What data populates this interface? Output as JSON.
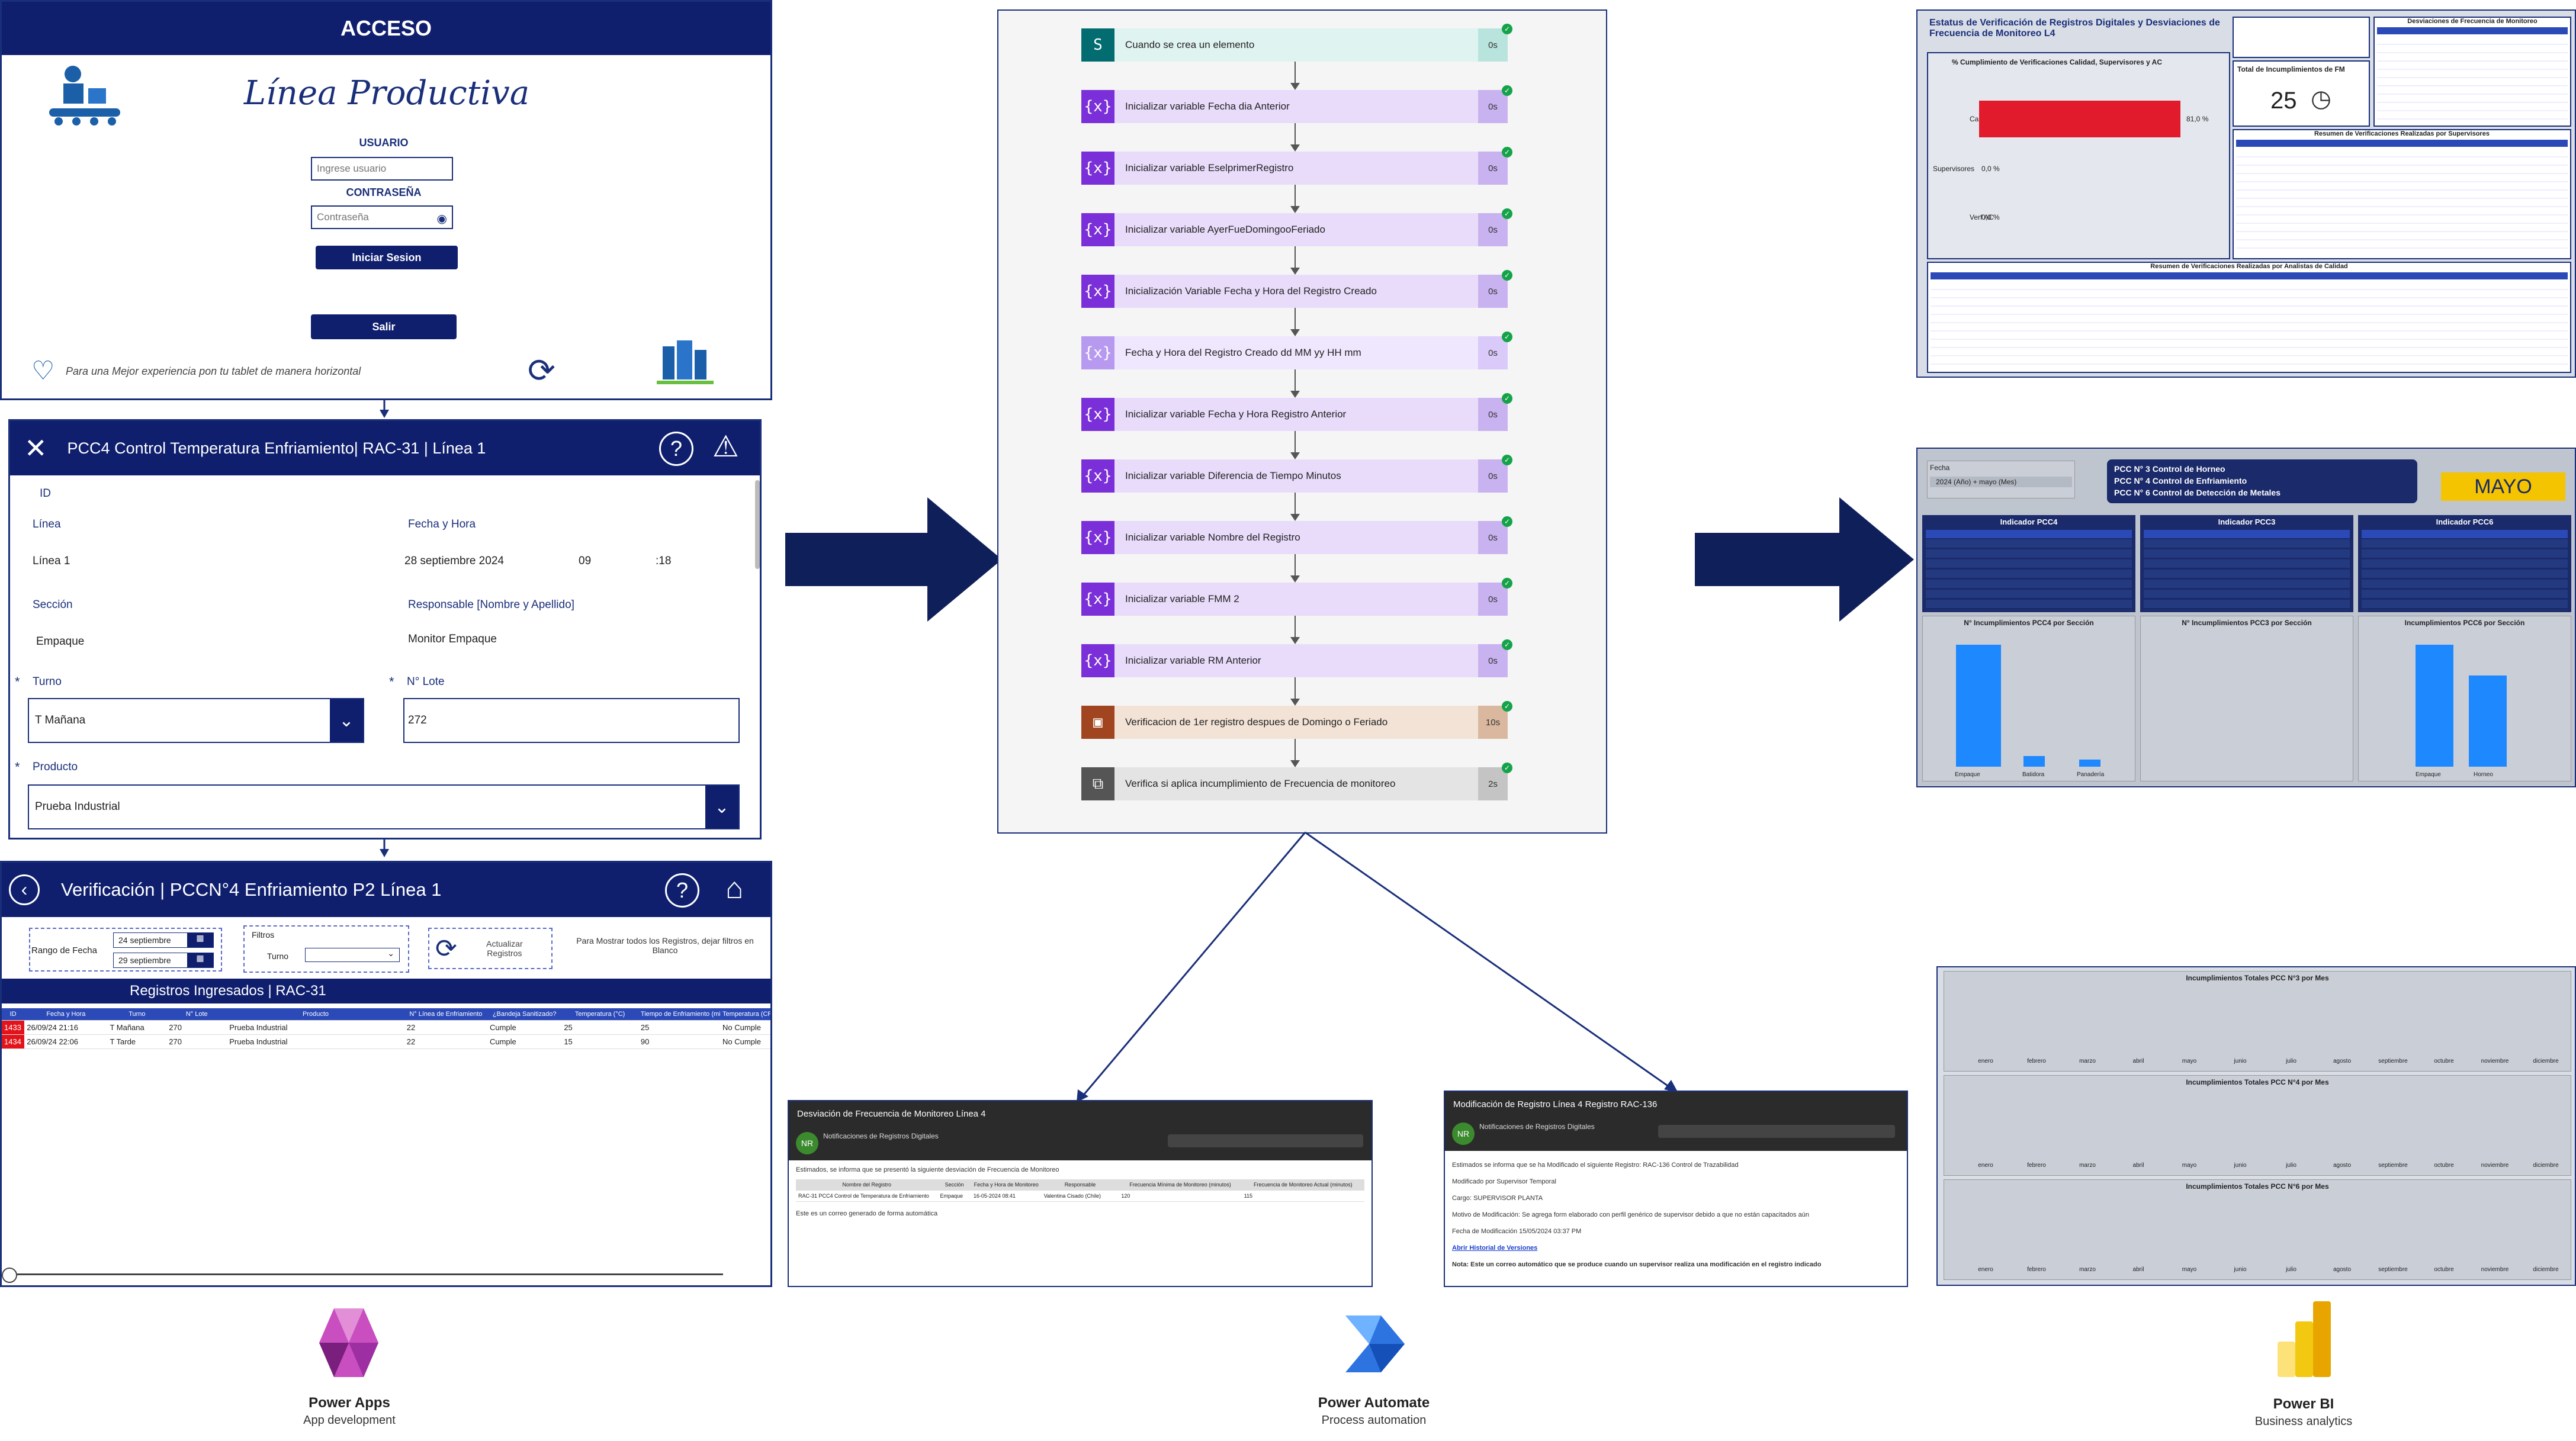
{
  "powerapps": {
    "login": {
      "header": "ACCESO",
      "title": "Línea Productiva",
      "user_label": "USUARIO",
      "user_placeholder": "Ingrese usuario",
      "pass_label": "CONTRASEÑA",
      "pass_placeholder": "Contraseña",
      "login_button": "Iniciar Sesion",
      "exit_button": "Salir",
      "footer_text": "Para una Mejor experiencia pon tu tablet de manera horizontal"
    },
    "form": {
      "header": "PCC4 Control Temperatura Enfriamiento| RAC-31 | Línea 1",
      "id_label": "ID",
      "linea_label": "Línea",
      "linea_value": "Línea 1",
      "fecha_label": "Fecha y Hora",
      "fecha_value": "28 septiembre 2024",
      "hora_value": "09",
      "min_value": ":18",
      "seccion_label": "Sección",
      "seccion_value": "Empaque",
      "responsable_label": "Responsable [Nombre y Apellido]",
      "responsable_value": "Monitor Empaque",
      "turno_label": "Turno",
      "turno_value": "T Mañana",
      "lote_label": "N° Lote",
      "lote_value": "272",
      "producto_label": "Producto",
      "producto_value": "Prueba Industrial"
    },
    "verif": {
      "header": "Verificación | PCCN°4 Enfriamiento P2 Línea 1",
      "rango_label": "Rango de Fecha",
      "date_from": "24 septiembre",
      "date_to": "29 septiembre",
      "filtros_label": "Filtros",
      "turno_label": "Turno",
      "actualizar_label": "Actualizar Registros",
      "hint": "Para Mostrar todos los Registros, dejar filtros en Blanco",
      "table_title": "Registros Ingresados | RAC-31",
      "columns": [
        "ID",
        "Fecha y Hora",
        "Turno",
        "N° Lote",
        "Producto",
        "N° Línea de Enfriamiento",
        "¿Bandeja Sanitizado?",
        "Temperatura (°C)",
        "Tiempo de Enfriamiento (min)",
        "Temperatura (CPK)"
      ],
      "rows": [
        [
          "1433",
          "26/09/24 21:16",
          "T Mañana",
          "270",
          "Prueba Industrial",
          "22",
          "Cumple",
          "25",
          "25",
          "No Cumple"
        ],
        [
          "1434",
          "26/09/24 22:06",
          "T Tarde",
          "270",
          "Prueba Industrial",
          "22",
          "Cumple",
          "15",
          "90",
          "No Cumple"
        ]
      ]
    }
  },
  "flow": {
    "steps": [
      {
        "label": "Cuando se crea un elemento",
        "time": "0s",
        "icon": "S",
        "color": "#036c70",
        "bg": "#dff3f0",
        "tbg": "#b9e4dd"
      },
      {
        "label": "Inicializar variable Fecha dia Anterior",
        "time": "0s",
        "icon": "{x}",
        "color": "#7a2fd8",
        "bg": "#e9dcfb",
        "tbg": "#c9b2f0"
      },
      {
        "label": "Inicializar variable EselprimerRegistro",
        "time": "0s",
        "icon": "{x}",
        "color": "#7a2fd8",
        "bg": "#e9dcfb",
        "tbg": "#c9b2f0"
      },
      {
        "label": "Inicializar variable AyerFueDomingooFeriado",
        "time": "0s",
        "icon": "{x}",
        "color": "#7a2fd8",
        "bg": "#e9dcfb",
        "tbg": "#c9b2f0"
      },
      {
        "label": "Inicialización Variable Fecha y Hora del Registro Creado",
        "time": "0s",
        "icon": "{x}",
        "color": "#7a2fd8",
        "bg": "#e9dcfb",
        "tbg": "#c9b2f0"
      },
      {
        "label": "Fecha y Hora del Registro Creado dd MM yy HH mm",
        "time": "0s",
        "icon": "{x}",
        "color": "#b79af0",
        "bg": "#efe7fd",
        "tbg": "#d9cafa"
      },
      {
        "label": "Inicializar variable Fecha y Hora Registro Anterior",
        "time": "0s",
        "icon": "{x}",
        "color": "#7a2fd8",
        "bg": "#e9dcfb",
        "tbg": "#c9b2f0"
      },
      {
        "label": "Inicializar variable Diferencia de Tiempo Minutos",
        "time": "0s",
        "icon": "{x}",
        "color": "#7a2fd8",
        "bg": "#e9dcfb",
        "tbg": "#c9b2f0"
      },
      {
        "label": "Inicializar variable Nombre del Registro",
        "time": "0s",
        "icon": "{x}",
        "color": "#7a2fd8",
        "bg": "#e9dcfb",
        "tbg": "#c9b2f0"
      },
      {
        "label": "Inicializar variable FMM 2",
        "time": "0s",
        "icon": "{x}",
        "color": "#7a2fd8",
        "bg": "#e9dcfb",
        "tbg": "#c9b2f0"
      },
      {
        "label": "Inicializar variable RM Anterior",
        "time": "0s",
        "icon": "{x}",
        "color": "#7a2fd8",
        "bg": "#e9dcfb",
        "tbg": "#c9b2f0"
      },
      {
        "label": "Verificacion de 1er registro despues de Domingo o Feriado",
        "time": "10s",
        "icon": "▣",
        "color": "#a0451f",
        "bg": "#f3e3d6",
        "tbg": "#d9b89f"
      },
      {
        "label": "Verifica si aplica incumplimiento de Frecuencia de monitoreo",
        "time": "2s",
        "icon": "⧉",
        "color": "#555555",
        "bg": "#e4e4e4",
        "tbg": "#c4c4c4"
      }
    ]
  },
  "emails": {
    "left": {
      "subject": "Desviación de Frecuencia de Monitoreo Línea 4",
      "sender": "Notificaciones de Registros Digitales",
      "body": "Estimados, se informa que se presentó la siguiente desviación de Frecuencia de Monitoreo",
      "cols": [
        "Nombre del Registro",
        "Sección",
        "Fecha y Hora de Monitoreo",
        "Responsable",
        "Frecuencia Mínima de Monitoreo (minutos)",
        "Frecuencia de Monitoreo Actual (minutos)"
      ],
      "row": [
        "RAC-31 PCC4 Control de Temperatura de Enfriamiento",
        "Empaque",
        "16-05-2024 08:41",
        "Valentina Cisado (Chile)",
        "120",
        "115"
      ],
      "footer": "Este es un correo generado de forma automática"
    },
    "right": {
      "subject": "Modificación de Registro  Línea 4 Registro RAC-136",
      "sender": "Notificaciones de Registros Digitales",
      "line1": "Estimados se informa que se ha Modificado el siguiente Registro: RAC-136 Control de Trazabilidad",
      "line2": "Modificado por Supervisor Temporal",
      "line3": "Cargo: SUPERVISOR PLANTA",
      "line4": "Motivo de Modificación: Se agrega form elaborado con perfil genérico de supervisor debido a que no están capacitados aún",
      "line5": "Fecha de Modificación 15/05/2024 03:37 PM",
      "link": "Abrir Historial de Versiones",
      "note": "Nota: Este un correo automático que se produce cuando un supervisor realiza una modificación en el registro indicado"
    }
  },
  "bi": {
    "d1": {
      "title": "Estatus de Verificación de Registros Digitales y Desviaciones de Frecuencia de Monitoreo L4",
      "pct_title": "% Cumplimiento de Verificaciones Calidad, Supervisores y AC",
      "calidad_label": "Calidad",
      "calidad_value": "81,0 %",
      "sup_label": "Supervisores",
      "sup_value": "0,0 %",
      "verf_label": "Verf AC",
      "verf_value": "0,0 %",
      "total_label": "Total de Incumplimientos de FM",
      "total_value": "25",
      "desv_title": "Desviaciones de Frecuencia de Monitoreo",
      "resumen_sup": "Resumen de Verificaciones Realizadas por Supervisores",
      "resumen_cal": "Resumen de Verificaciones Realizadas por Analistas de Calidad"
    },
    "d2": {
      "fecha_label": "Fecha",
      "fecha_value": "2024 (Año) + mayo (Mes)",
      "pcc_lines": [
        "PCC N° 3 Control de Horneo",
        "PCC N° 4 Control de Enfriamiento",
        "PCC N° 6 Control de Detección de Metales"
      ],
      "month": "MAYO",
      "ind4": "Indicador PCC4",
      "ind3": "Indicador PCC3",
      "ind6": "Indicador PCC6",
      "ch4": "N° Incumplimientos PCC4 por Sección",
      "ch3": "N° Incumplimientos PCC3 por Sección",
      "ch6": "Incumplimientos PCC6 por Sección",
      "cat1": "Empaque",
      "cat2": "Batidora",
      "cat3": "Panadería",
      "cat4": "Empaque",
      "cat5": "Horneo"
    },
    "d3": {
      "t1": "Incumplimientos Totales PCC N°3 por Mes",
      "t2": "Incumplimientos Totales PCC N°4 por Mes",
      "t3": "Incumplimientos Totales PCC N°6 por Mes",
      "months": [
        "enero",
        "febrero",
        "marzo",
        "abril",
        "mayo",
        "junio",
        "julio",
        "agosto",
        "septiembre",
        "octubre",
        "noviembre",
        "diciembre"
      ]
    }
  },
  "logos": {
    "pa_name": "Power Apps",
    "pa_sub": "App development",
    "pauto_name": "Power Automate",
    "pauto_sub": "Process automation",
    "pbi_name": "Power BI",
    "pbi_sub": "Business analytics"
  }
}
